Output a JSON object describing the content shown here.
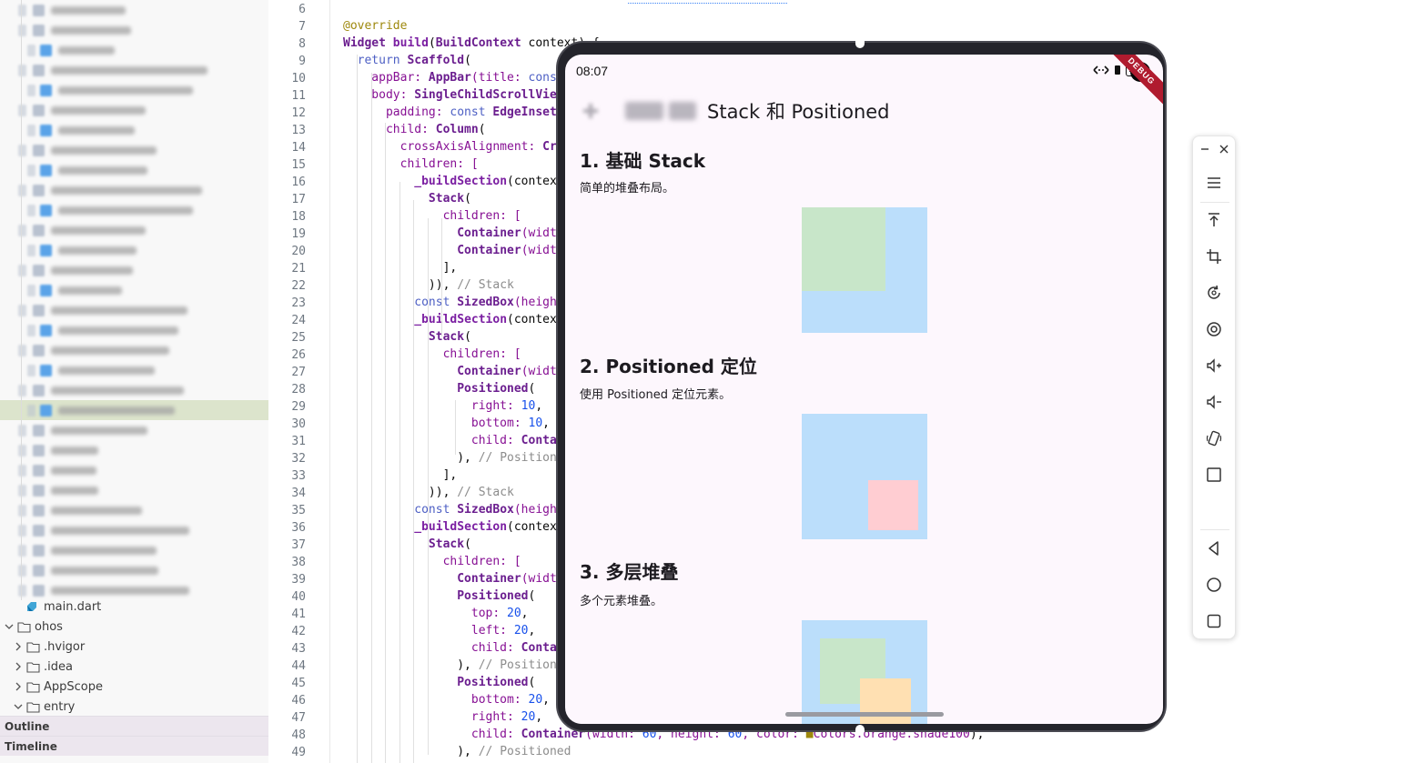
{
  "explorer": {
    "files": [
      {
        "label": "main.dart",
        "icon": "dart-file-icon"
      }
    ],
    "folders": [
      {
        "label": "ohos",
        "expanded": true
      },
      {
        "label": ".hvigor",
        "expanded": false
      },
      {
        "label": ".idea",
        "expanded": false
      },
      {
        "label": "AppScope",
        "expanded": false
      },
      {
        "label": "entry",
        "expanded": true
      }
    ],
    "panels": {
      "outline": "Outline",
      "timeline": "Timeline"
    }
  },
  "editor": {
    "line_numbers": [
      "6",
      "7",
      "8",
      "9",
      "10",
      "11",
      "12",
      "13",
      "14",
      "15",
      "16",
      "17",
      "18",
      "19",
      "20",
      "21",
      "22",
      "23",
      "24",
      "25",
      "26",
      "27",
      "28",
      "29",
      "30",
      "31",
      "32",
      "33",
      "34",
      "35",
      "36",
      "37",
      "38",
      "39",
      "40",
      "41",
      "42",
      "43",
      "44",
      "45",
      "46",
      "47",
      "48",
      "49"
    ]
  },
  "device": {
    "status_time": "08:07",
    "battery": "100",
    "debug_banner": "DEBUG",
    "appbar_title": "Stack 和 Positioned",
    "sections": [
      {
        "title": "1. 基础 Stack",
        "desc": "简单的堆叠布局。"
      },
      {
        "title": "2. Positioned 定位",
        "desc": "使用 Positioned 定位元素。"
      },
      {
        "title": "3. 多层堆叠",
        "desc": "多个元素堆叠。"
      }
    ],
    "colors": {
      "blue_shade100": "#bbdefb",
      "green_shade100": "#c8e6c9",
      "red_shade100": "#ffcdd2",
      "orange_shade100": "#ffe0b2",
      "background": "#fdf7fd"
    }
  },
  "emulator_toolbar": {
    "buttons": [
      {
        "name": "minimize-icon"
      },
      {
        "name": "close-icon"
      },
      {
        "name": "menu-icon"
      },
      {
        "name": "pin-top-icon"
      },
      {
        "name": "screenshot-crop-icon"
      },
      {
        "name": "rotate-icon"
      },
      {
        "name": "screen-record-icon"
      },
      {
        "name": "volume-up-icon"
      },
      {
        "name": "volume-down-icon"
      },
      {
        "name": "shake-icon"
      },
      {
        "name": "fold-screen-icon"
      },
      {
        "name": "back-icon"
      },
      {
        "name": "home-icon"
      },
      {
        "name": "recents-icon"
      }
    ]
  }
}
